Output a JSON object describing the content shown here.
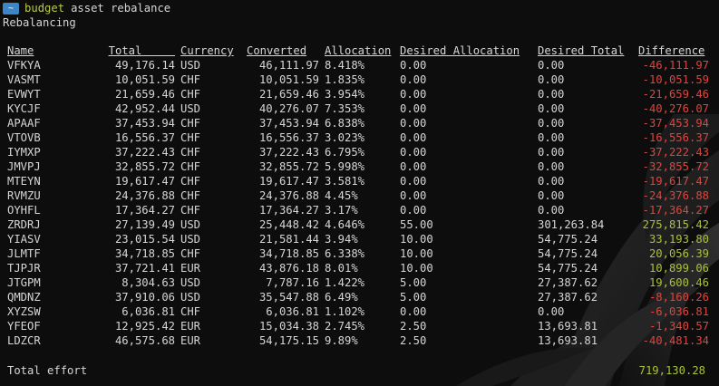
{
  "prompt": {
    "badge": "~",
    "command": "budget",
    "args": "asset rebalance"
  },
  "section_title": "Rebalancing",
  "table": {
    "headers": {
      "name": "Name",
      "total": "Total",
      "currency": "Currency",
      "converted": "Converted",
      "allocation": "Allocation",
      "desired_allocation": "Desired Allocation",
      "desired_total": "Desired Total",
      "difference": "Difference"
    },
    "rows": [
      {
        "name": "VFKYA",
        "total": "49,176.14",
        "currency": "USD",
        "converted": "46,111.97",
        "allocation": "8.418%",
        "desired_allocation": "0.00",
        "desired_total": "0.00",
        "difference": "-46,111.97",
        "sign": "neg"
      },
      {
        "name": "VASMT",
        "total": "10,051.59",
        "currency": "CHF",
        "converted": "10,051.59",
        "allocation": "1.835%",
        "desired_allocation": "0.00",
        "desired_total": "0.00",
        "difference": "-10,051.59",
        "sign": "neg"
      },
      {
        "name": "EVWYT",
        "total": "21,659.46",
        "currency": "CHF",
        "converted": "21,659.46",
        "allocation": "3.954%",
        "desired_allocation": "0.00",
        "desired_total": "0.00",
        "difference": "-21,659.46",
        "sign": "neg"
      },
      {
        "name": "KYCJF",
        "total": "42,952.44",
        "currency": "USD",
        "converted": "40,276.07",
        "allocation": "7.353%",
        "desired_allocation": "0.00",
        "desired_total": "0.00",
        "difference": "-40,276.07",
        "sign": "neg"
      },
      {
        "name": "APAAF",
        "total": "37,453.94",
        "currency": "CHF",
        "converted": "37,453.94",
        "allocation": "6.838%",
        "desired_allocation": "0.00",
        "desired_total": "0.00",
        "difference": "-37,453.94",
        "sign": "neg"
      },
      {
        "name": "VTOVB",
        "total": "16,556.37",
        "currency": "CHF",
        "converted": "16,556.37",
        "allocation": "3.023%",
        "desired_allocation": "0.00",
        "desired_total": "0.00",
        "difference": "-16,556.37",
        "sign": "neg"
      },
      {
        "name": "IYMXP",
        "total": "37,222.43",
        "currency": "CHF",
        "converted": "37,222.43",
        "allocation": "6.795%",
        "desired_allocation": "0.00",
        "desired_total": "0.00",
        "difference": "-37,222.43",
        "sign": "neg"
      },
      {
        "name": "JMVPJ",
        "total": "32,855.72",
        "currency": "CHF",
        "converted": "32,855.72",
        "allocation": "5.998%",
        "desired_allocation": "0.00",
        "desired_total": "0.00",
        "difference": "-32,855.72",
        "sign": "neg"
      },
      {
        "name": "MTEYN",
        "total": "19,617.47",
        "currency": "CHF",
        "converted": "19,617.47",
        "allocation": "3.581%",
        "desired_allocation": "0.00",
        "desired_total": "0.00",
        "difference": "-19,617.47",
        "sign": "neg"
      },
      {
        "name": "RVMZU",
        "total": "24,376.88",
        "currency": "CHF",
        "converted": "24,376.88",
        "allocation": "4.45%",
        "desired_allocation": "0.00",
        "desired_total": "0.00",
        "difference": "-24,376.88",
        "sign": "neg"
      },
      {
        "name": "OYHFL",
        "total": "17,364.27",
        "currency": "CHF",
        "converted": "17,364.27",
        "allocation": "3.17%",
        "desired_allocation": "0.00",
        "desired_total": "0.00",
        "difference": "-17,364.27",
        "sign": "neg"
      },
      {
        "name": "ZRDRJ",
        "total": "27,139.49",
        "currency": "USD",
        "converted": "25,448.42",
        "allocation": "4.646%",
        "desired_allocation": "55.00",
        "desired_total": "301,263.84",
        "difference": "275,815.42",
        "sign": "pos"
      },
      {
        "name": "YIASV",
        "total": "23,015.54",
        "currency": "USD",
        "converted": "21,581.44",
        "allocation": "3.94%",
        "desired_allocation": "10.00",
        "desired_total": "54,775.24",
        "difference": "33,193.80",
        "sign": "pos"
      },
      {
        "name": "JLMTF",
        "total": "34,718.85",
        "currency": "CHF",
        "converted": "34,718.85",
        "allocation": "6.338%",
        "desired_allocation": "10.00",
        "desired_total": "54,775.24",
        "difference": "20,056.39",
        "sign": "pos"
      },
      {
        "name": "TJPJR",
        "total": "37,721.41",
        "currency": "EUR",
        "converted": "43,876.18",
        "allocation": "8.01%",
        "desired_allocation": "10.00",
        "desired_total": "54,775.24",
        "difference": "10,899.06",
        "sign": "pos"
      },
      {
        "name": "JTGPM",
        "total": "8,304.63",
        "currency": "USD",
        "converted": "7,787.16",
        "allocation": "1.422%",
        "desired_allocation": "5.00",
        "desired_total": "27,387.62",
        "difference": "19,600.46",
        "sign": "pos"
      },
      {
        "name": "QMDNZ",
        "total": "37,910.06",
        "currency": "USD",
        "converted": "35,547.88",
        "allocation": "6.49%",
        "desired_allocation": "5.00",
        "desired_total": "27,387.62",
        "difference": "-8,160.26",
        "sign": "neg"
      },
      {
        "name": "XYZSW",
        "total": "6,036.81",
        "currency": "CHF",
        "converted": "6,036.81",
        "allocation": "1.102%",
        "desired_allocation": "0.00",
        "desired_total": "0.00",
        "difference": "-6,036.81",
        "sign": "neg"
      },
      {
        "name": "YFEOF",
        "total": "12,925.42",
        "currency": "EUR",
        "converted": "15,034.38",
        "allocation": "2.745%",
        "desired_allocation": "2.50",
        "desired_total": "13,693.81",
        "difference": "-1,340.57",
        "sign": "neg"
      },
      {
        "name": "LDZCR",
        "total": "46,575.68",
        "currency": "EUR",
        "converted": "54,175.15",
        "allocation": "9.89%",
        "desired_allocation": "2.50",
        "desired_total": "13,693.81",
        "difference": "-40,481.34",
        "sign": "neg"
      }
    ]
  },
  "total_effort": {
    "label": "Total effort",
    "value": "719,130.28"
  },
  "colors": {
    "negative": "#e0443e",
    "positive": "#a8c23a",
    "prompt_badge": "#3a86c8",
    "command": "#b9c94f"
  }
}
